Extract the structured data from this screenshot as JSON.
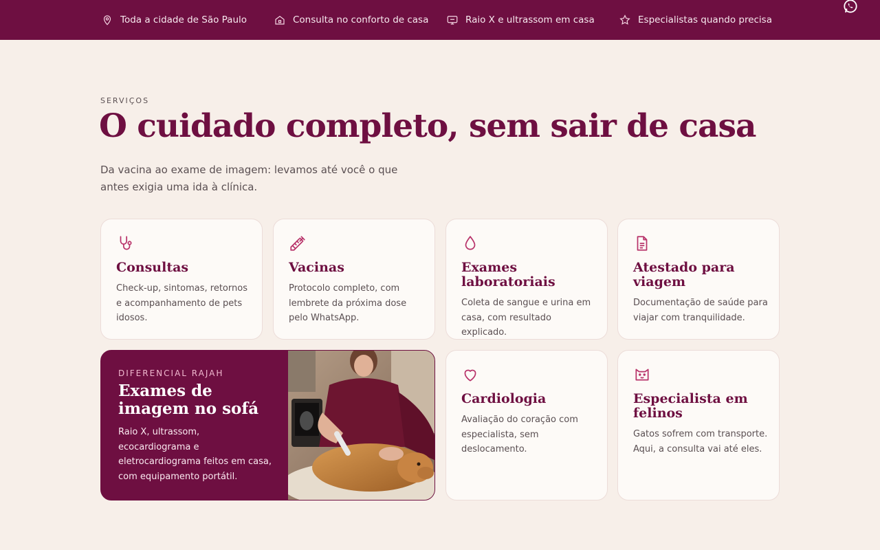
{
  "topbar": {
    "items": [
      {
        "icon": "map-pin-icon",
        "label": "Toda a cidade de São Paulo"
      },
      {
        "icon": "home-icon",
        "label": "Consulta no conforto de casa"
      },
      {
        "icon": "monitor-icon",
        "label": "Raio X e ultrassom em casa"
      },
      {
        "icon": "star-icon",
        "label": "Especialistas quando precisa"
      }
    ],
    "whatsapp_icon": "whatsapp-icon"
  },
  "section": {
    "eyebrow": "SERVIÇOS",
    "title": "O cuidado completo, sem sair de casa",
    "lead": "Da vacina ao exame de imagem: levamos até você o que antes exigia uma ida à clínica."
  },
  "cards": [
    {
      "icon": "stethoscope-icon",
      "title": "Consultas",
      "text": "Check-up, sintomas, retornos e acompanhamento de pets idosos."
    },
    {
      "icon": "syringe-icon",
      "title": "Vacinas",
      "text": "Protocolo completo, com lembrete da próxima dose pelo WhatsApp."
    },
    {
      "icon": "drop-icon",
      "title": "Exames laboratoriais",
      "text": "Coleta de sangue e urina em casa, com resultado explicado."
    },
    {
      "icon": "document-icon",
      "title": "Atestado para viagem",
      "text": "Documentação de saúde para viajar com tranquilidade."
    },
    {
      "icon": "heart-icon",
      "title": "Cardiologia",
      "text": "Avaliação do coração com especialista, sem deslocamento."
    },
    {
      "icon": "cat-icon",
      "title": "Especialista em felinos",
      "text": "Gatos sofrem com transporte. Aqui, a consulta vai até eles."
    }
  ],
  "feature": {
    "tag": "DIFERENCIAL RAJAH",
    "title": "Exames de imagem no sofá",
    "text": "Raio X, ultrassom, ecocardiograma e eletrocardiograma feitos em casa, com equipamento portátil."
  },
  "colors": {
    "brand": "#6e0f41",
    "background": "#f7efe9",
    "card": "#fdfaf7",
    "accent_pink": "#c0497a"
  }
}
